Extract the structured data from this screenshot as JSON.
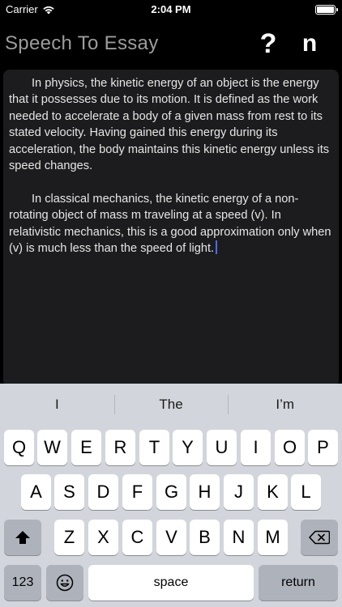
{
  "status_bar": {
    "carrier": "Carrier",
    "time": "2:04 PM"
  },
  "nav": {
    "title": "Speech To Essay",
    "help_label": "?",
    "n_label": "n"
  },
  "editor": {
    "paragraphs": [
      "In physics, the kinetic energy of an object is the energy that it possesses due to its motion. It is defined as the work needed to accelerate a body of a given mass from rest to its stated velocity. Having gained this energy during its acceleration, the body maintains this kinetic energy unless its speed changes.",
      "In classical mechanics, the kinetic energy of a non-rotating object of mass m traveling at a speed (v). In relativistic mechanics, this is a good approximation only when (v) is much less than the speed of light."
    ]
  },
  "keyboard": {
    "suggestions": [
      "I",
      "The",
      "I’m"
    ],
    "row1": [
      "Q",
      "W",
      "E",
      "R",
      "T",
      "Y",
      "U",
      "I",
      "O",
      "P"
    ],
    "row2": [
      "A",
      "S",
      "D",
      "F",
      "G",
      "H",
      "J",
      "K",
      "L"
    ],
    "row3": [
      "Z",
      "X",
      "C",
      "V",
      "B",
      "N",
      "M"
    ],
    "numbers_label": "123",
    "space_label": "space",
    "return_label": "return"
  }
}
